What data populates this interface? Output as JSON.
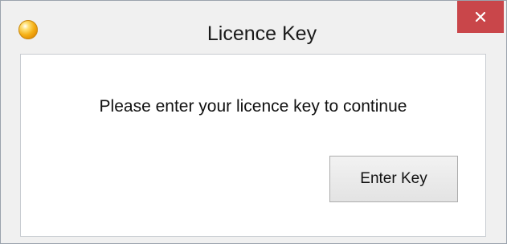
{
  "window": {
    "title": "Licence Key",
    "app_icon": "orange-orb-icon",
    "close_icon": "close-icon"
  },
  "dialog": {
    "message": "Please enter your licence key to continue",
    "enter_key_label": "Enter Key"
  },
  "colors": {
    "close_button_bg": "#c9464a",
    "window_bg": "#f0f0f0",
    "content_bg": "#ffffff"
  }
}
